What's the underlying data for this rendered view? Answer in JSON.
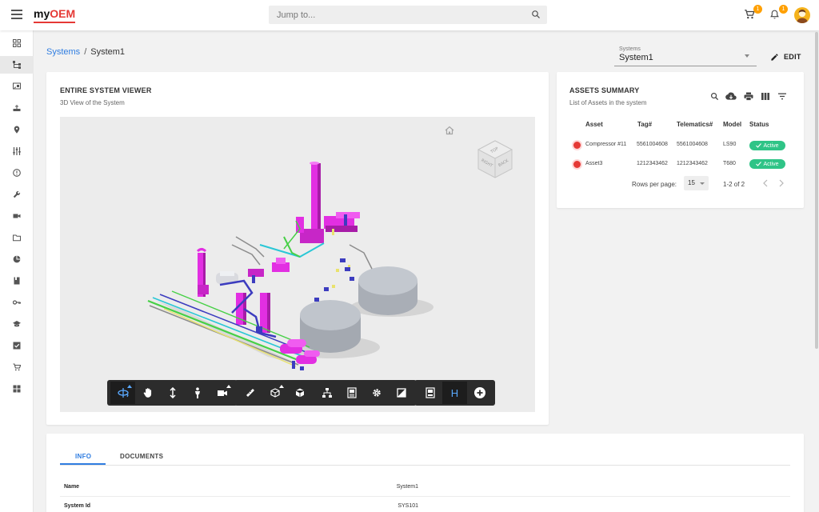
{
  "header": {
    "logo_prefix": "my",
    "logo_suffix": "OEM",
    "search_placeholder": "Jump to...",
    "cart_count": "1",
    "notification_count": "1"
  },
  "sidebar": {
    "items": [
      {
        "icon": "dashboard-icon"
      },
      {
        "icon": "hierarchy-icon",
        "active": true
      },
      {
        "icon": "cast-icon"
      },
      {
        "icon": "router-icon"
      },
      {
        "icon": "location-pin-icon"
      },
      {
        "icon": "tune-icon"
      },
      {
        "icon": "alert-circle-icon"
      },
      {
        "icon": "wrench-icon"
      },
      {
        "icon": "video-icon"
      },
      {
        "icon": "folder-icon"
      },
      {
        "icon": "pie-chart-icon"
      },
      {
        "icon": "book-icon"
      },
      {
        "icon": "key-icon"
      },
      {
        "icon": "school-icon"
      },
      {
        "icon": "checklist-icon"
      },
      {
        "icon": "cart-icon"
      },
      {
        "icon": "widgets-icon"
      }
    ]
  },
  "breadcrumb": {
    "root": "Systems",
    "separator": "/",
    "current": "System1"
  },
  "system_selector": {
    "label": "Systems",
    "value": "System1"
  },
  "edit_label": "EDIT",
  "viewer_card": {
    "title": "ENTIRE SYSTEM VIEWER",
    "subtitle": "3D View of the System",
    "navcube_faces": [
      "RIGHT",
      "BACK",
      "TOP"
    ]
  },
  "toolbar": {
    "groups": [
      [
        "orbit",
        "pan",
        "dolly",
        "first-person",
        "camera"
      ],
      [
        "measure",
        "explode",
        "model-browser"
      ],
      [
        "structure",
        "properties",
        "settings",
        "fullscreen"
      ],
      [
        "document-browser",
        "h-tool",
        "add"
      ]
    ],
    "h_label": "H"
  },
  "assets_card": {
    "title": "ASSETS SUMMARY",
    "subtitle": "List of Assets in the system",
    "columns": [
      "Asset",
      "Tag#",
      "Telematics#",
      "Model",
      "Status"
    ],
    "rows": [
      {
        "asset": "Compressor #11",
        "tag": "5561004608",
        "telematics": "5561004608",
        "model": "LS90",
        "status": "Active"
      },
      {
        "asset": "Asset3",
        "tag": "1212343462",
        "telematics": "1212343462",
        "model": "T680",
        "status": "Active"
      }
    ],
    "rows_per_page_label": "Rows per page:",
    "rows_per_page": "15",
    "range": "1-2 of 2",
    "status_color": "#2fc487",
    "alert_color": "#e53935"
  },
  "tabs": {
    "items": [
      "INFO",
      "DOCUMENTS"
    ],
    "active": "INFO",
    "accent": "#2f7de1"
  },
  "info": {
    "rows": [
      {
        "key": "Name",
        "value": "System1"
      },
      {
        "key": "System Id",
        "value": "SYS101"
      }
    ]
  }
}
